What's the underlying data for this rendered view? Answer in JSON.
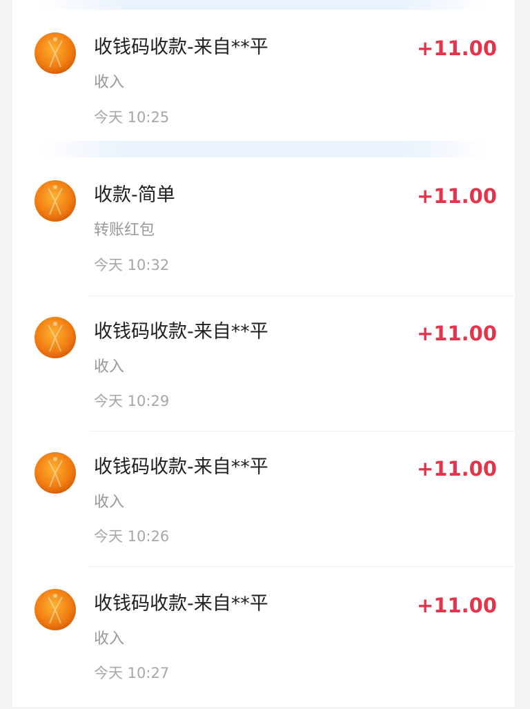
{
  "transactions": [
    {
      "title": "收钱码收款-来自**平",
      "category": "收入",
      "time": "今天 10:25",
      "amount": "+11.00"
    },
    {
      "title": "收款-简单",
      "category": "转账红包",
      "time": "今天 10:32",
      "amount": "+11.00"
    },
    {
      "title": "收钱码收款-来自**平",
      "category": "收入",
      "time": "今天 10:29",
      "amount": "+11.00"
    },
    {
      "title": "收钱码收款-来自**平",
      "category": "收入",
      "time": "今天 10:26",
      "amount": "+11.00"
    },
    {
      "title": "收钱码收款-来自**平",
      "category": "收入",
      "time": "今天 10:27",
      "amount": "+11.00"
    }
  ],
  "colors": {
    "amount": "#e2344a",
    "title": "#1e1e1e",
    "secondary": "#999999"
  },
  "icons": {
    "avatar": "orange-flame-avatar-icon"
  }
}
